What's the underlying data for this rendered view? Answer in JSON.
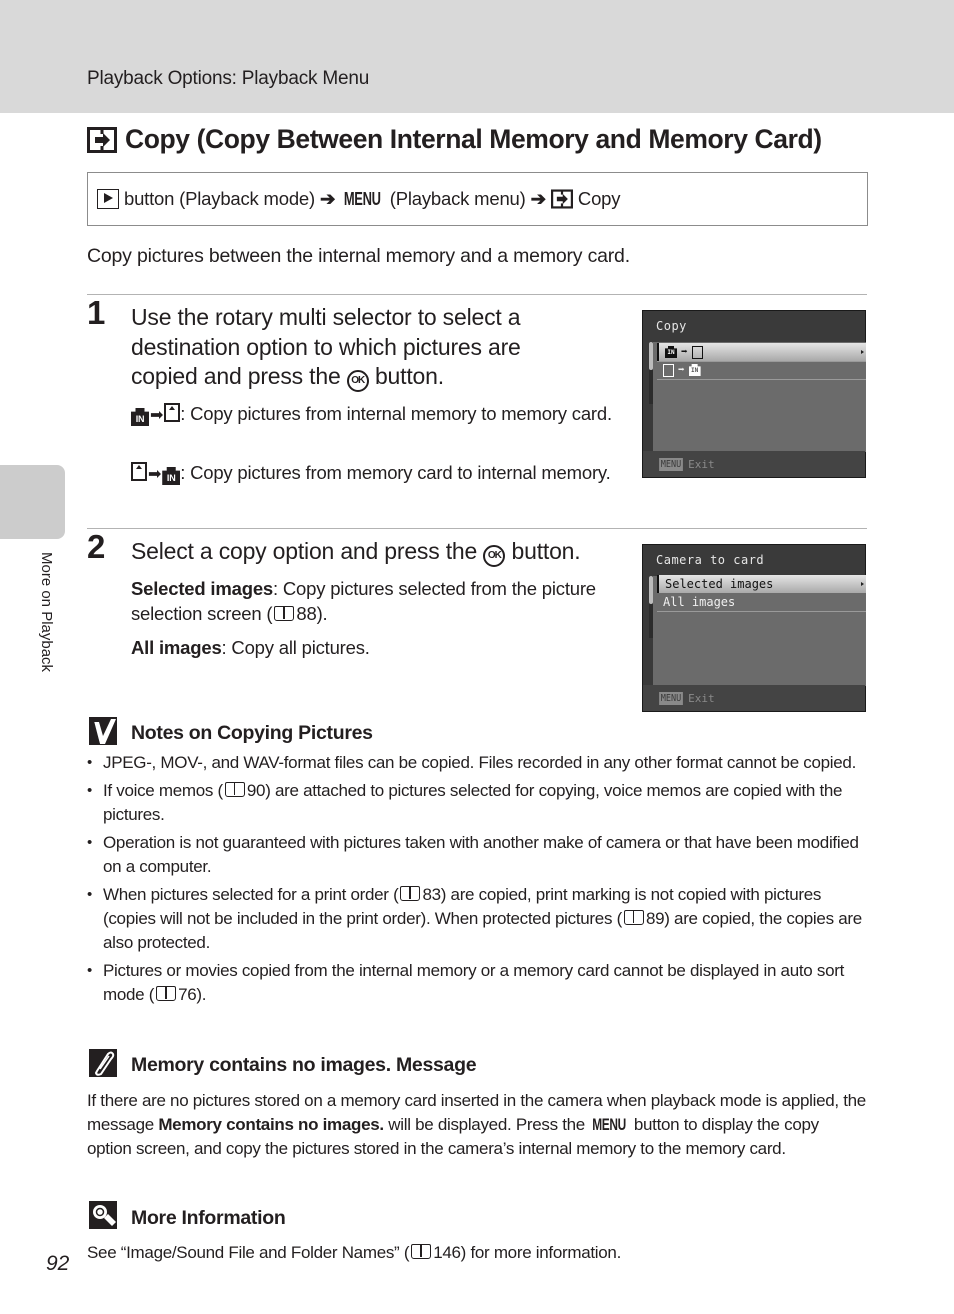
{
  "header": {
    "section_title": "Playback Options: Playback Menu"
  },
  "side_tab": {
    "label": "More on Playback"
  },
  "page": {
    "title_icon": "copy-icon",
    "title": "Copy (Copy Between Internal Memory and Memory Card)",
    "number": "92"
  },
  "nav_path": {
    "play_icon": "playback-button-icon",
    "part1": "button (Playback mode)",
    "arrow1": "➔",
    "menu_label": "MENU",
    "part2": "(Playback menu)",
    "arrow2": "➔",
    "part3": "Copy"
  },
  "intro": "Copy pictures between the internal memory and a memory card.",
  "steps": [
    {
      "number": "1",
      "head_before_ok": "Use the rotary multi selector to select a destination option to which pictures are copied and press the",
      "ok_label": "OK",
      "head_after_ok": "button.",
      "options": [
        {
          "from_icon": "internal-memory-icon",
          "to_icon": "memory-card-icon",
          "in_label": "IN",
          "arrow": "➡",
          "description": ": Copy pictures from internal memory to memory card."
        },
        {
          "from_icon": "memory-card-icon",
          "to_icon": "internal-memory-icon",
          "in_label": "IN",
          "arrow": "➡",
          "description": ": Copy pictures from memory card to internal memory."
        }
      ],
      "screen": {
        "title": "Copy",
        "rows": [
          {
            "label": "IN ➡ card",
            "selected": true
          },
          {
            "label": "card ➡ IN",
            "selected": false
          }
        ],
        "footer_badge": "MENU",
        "footer_label": "Exit"
      }
    },
    {
      "number": "2",
      "head_before_ok": "Select a copy option and press the",
      "ok_label": "OK",
      "head_after_ok": "button.",
      "options": [
        {
          "term": "Selected images",
          "desc_before_ref": ":  Copy pictures selected from the picture selection screen (",
          "ref": "88",
          "desc_after_ref": ")."
        },
        {
          "term": "All images",
          "desc": ": Copy all pictures."
        }
      ],
      "screen": {
        "title": "Camera to card",
        "rows": [
          {
            "label": "Selected images",
            "selected": true
          },
          {
            "label": "All images",
            "selected": false
          }
        ],
        "footer_badge": "MENU",
        "footer_label": "Exit"
      }
    }
  ],
  "notes": {
    "icon": "check-note-icon",
    "heading": "Notes on Copying Pictures",
    "bullets": [
      {
        "before": "JPEG-, MOV-, and WAV-format files can be copied. Files recorded in any other format cannot be copied."
      },
      {
        "before": "If voice memos (",
        "ref": "90",
        "after": ") are attached to pictures selected for copying, voice memos are copied with the pictures."
      },
      {
        "before": "Operation is not guaranteed with pictures taken with another make of camera or that have been modified on a computer."
      },
      {
        "before": "When pictures selected for a print order (",
        "ref": "83",
        "middle": ") are copied, print marking is not copied with pictures (copies will not be included in the print order). When protected pictures (",
        "ref2": "89",
        "after": ") are copied, the copies are also protected."
      },
      {
        "before": "Pictures or movies copied from the internal memory or a memory card cannot be displayed in auto sort mode (",
        "ref": "76",
        "after": ")."
      }
    ]
  },
  "memory_message": {
    "icon": "pencil-note-icon",
    "heading": "Memory contains no images. Message",
    "text_1": "If there are no pictures stored on a memory card inserted in the camera when playback mode is applied, the message ",
    "bold_1": "Memory contains no images.",
    "text_2": " will be displayed. Press the ",
    "menu_label": "MENU",
    "text_3": " button to display the copy option screen, and copy the pictures stored in the camera’s internal memory to the memory card."
  },
  "more_info": {
    "icon": "magnifier-info-icon",
    "heading": "More Information",
    "text_before": "See “Image/Sound File and Folder Names” (",
    "ref": "146",
    "text_after": ") for more information."
  }
}
